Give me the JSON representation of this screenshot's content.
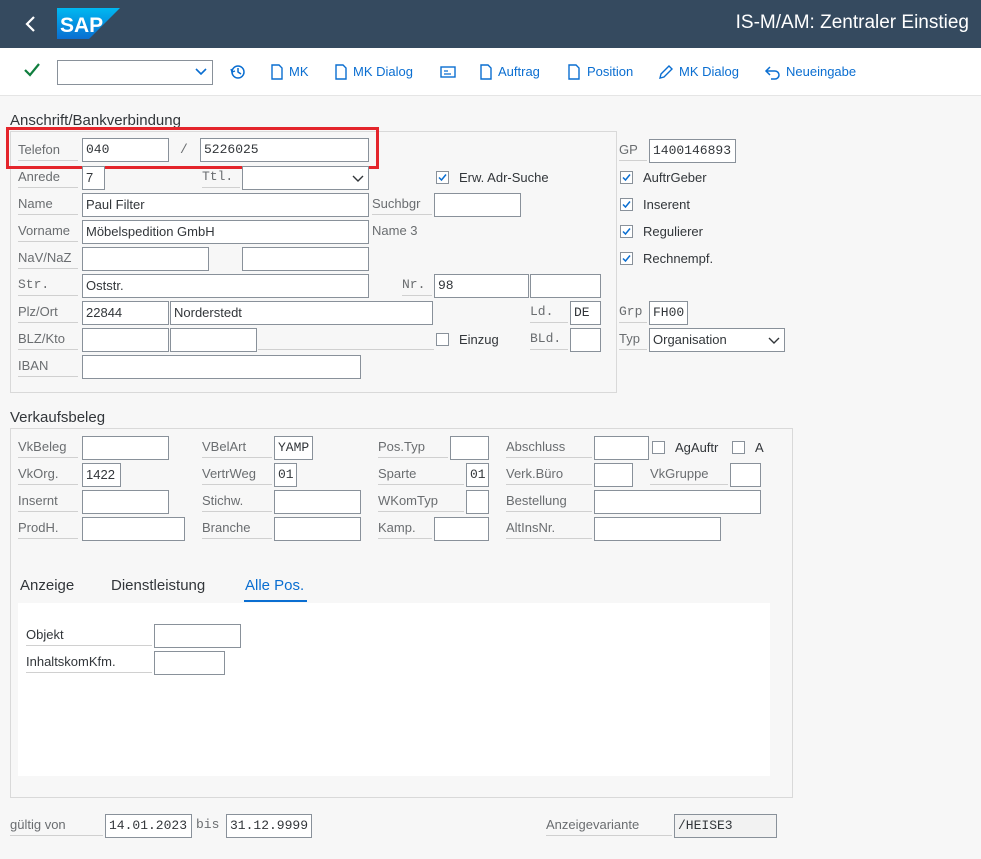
{
  "shell": {
    "title": "IS-M/AM: Zentraler Einstieg",
    "logo_text": "SAP"
  },
  "toolbar": {
    "combo_value": "",
    "buttons": [
      {
        "label": "MK",
        "icon": "document-icon"
      },
      {
        "label": "MK Dialog",
        "icon": "document-icon"
      },
      {
        "label": "Auftrag",
        "icon": "document-icon"
      },
      {
        "label": "Position",
        "icon": "document-icon"
      },
      {
        "label": "MK Dialog",
        "icon": "pencil-icon"
      },
      {
        "label": "Neueingabe",
        "icon": "undo-icon"
      }
    ]
  },
  "address": {
    "title": "Anschrift/Bankverbindung",
    "telefon_label": "Telefon",
    "telefon_area": "040",
    "telefon_sep": "/",
    "telefon_number": "5226025",
    "anrede_label": "Anrede",
    "anrede_value": "7",
    "ttl_label": "Ttl.",
    "ttl_value": "",
    "erw_label": "Erw. Adr-Suche",
    "erw_checked": true,
    "name_label": "Name",
    "name_value": "Paul Filter",
    "suchbgr_label": "Suchbgr",
    "suchbgr_value": "",
    "vorname_label": "Vorname",
    "vorname_value": "Möbelspedition GmbH",
    "name3_label": "Name 3",
    "nav_label": "NaV/NaZ",
    "nav_value1": "",
    "nav_value2": "",
    "str_label": "Str.",
    "str_value": "Oststr.",
    "nr_label": "Nr.",
    "nr_value": "98",
    "nr_value2": "",
    "plz_label": "Plz/Ort",
    "plz_value": "22844",
    "ort_value": "Norderstedt",
    "ld_label": "Ld.",
    "ld_value": "DE",
    "blz_label": "BLZ/Kto",
    "blz_value": "",
    "kto_value": "",
    "einzug_label": "Einzug",
    "einzug_checked": false,
    "bld_label": "BLd.",
    "bld_value": "",
    "iban_label": "IBAN",
    "iban_value": ""
  },
  "gp": {
    "gp_label": "GP",
    "gp_value": "1400146893",
    "roles": [
      {
        "label": "AuftrGeber",
        "checked": true
      },
      {
        "label": "Inserent",
        "checked": true
      },
      {
        "label": "Regulierer",
        "checked": true
      },
      {
        "label": "Rechnempf.",
        "checked": true
      }
    ],
    "grp_label": "Grp",
    "grp_value": "FH00",
    "typ_label": "Typ",
    "typ_value": "Organisation"
  },
  "sales": {
    "title": "Verkaufsbeleg",
    "vkbeleg_label": "VkBeleg",
    "vkbeleg_value": "",
    "vbelart_label": "VBelArt",
    "vbelart_value": "YAMP",
    "postyp_label": "Pos.Typ",
    "postyp_value": "",
    "abschluss_label": "Abschluss",
    "abschluss_value": "",
    "agauftr_label": "AgAuftr",
    "agauftr_checked": false,
    "a_label": "A",
    "a_checked": false,
    "vkorg_label": "VkOrg.",
    "vkorg_value": "1422",
    "vertrweg_label": "VertrWeg",
    "vertrweg_value": "01",
    "sparte_label": "Sparte",
    "sparte_value": "01",
    "verkburo_label": "Verk.Büro",
    "verkburo_value": "",
    "vkgruppe_label": "VkGruppe",
    "vkgruppe_value": "",
    "insernt_label": "Insernt",
    "insernt_value": "",
    "stichw_label": "Stichw.",
    "stichw_value": "",
    "wkomtyp_label": "WKomTyp",
    "wkomtyp_value": "",
    "bestellung_label": "Bestellung",
    "bestellung_value": "",
    "prodh_label": "ProdH.",
    "prodh_value": "",
    "branche_label": "Branche",
    "branche_value": "",
    "kamp_label": "Kamp.",
    "kamp_value": "",
    "altinsnr_label": "AltInsNr.",
    "altinsnr_value": "",
    "tabs": [
      "Anzeige",
      "Dienstleistung",
      "Alle Pos."
    ],
    "selected_tab": "Alle Pos.",
    "objekt_label": "Objekt",
    "objekt_value": "",
    "inhalts_label": "InhaltskomKfm.",
    "inhalts_value": ""
  },
  "footer": {
    "gultig_label": "gültig von",
    "from_value": "14.01.2023",
    "bis_label": "bis",
    "to_value": "31.12.9999",
    "variante_label": "Anzeigevariante",
    "variante_value": "/HEISE3"
  },
  "colors": {
    "shell": "#354a5f",
    "accent": "#0a6ed1",
    "highlight": "#e4252b",
    "confirm": "#107e3e"
  }
}
